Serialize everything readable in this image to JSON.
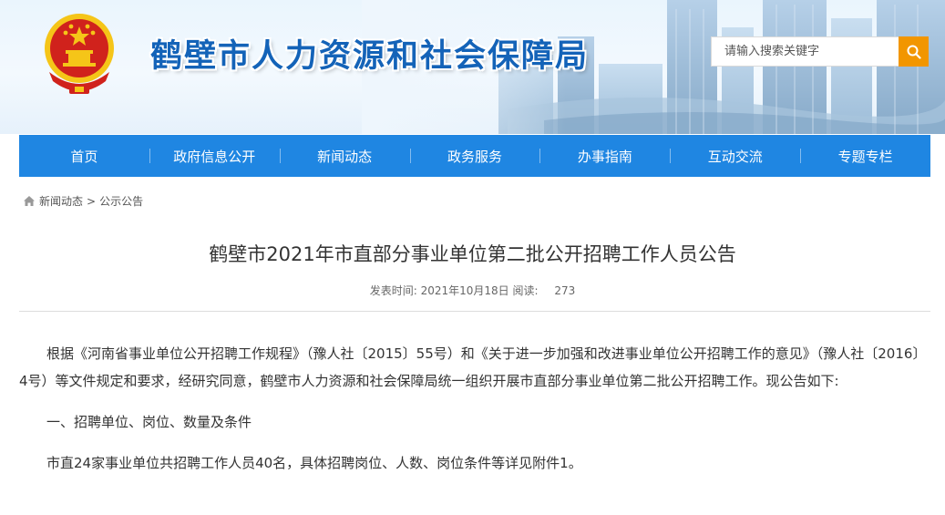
{
  "header": {
    "site_title": "鹤壁市人力资源和社会保障局",
    "search_placeholder": "请输入搜索关键字",
    "emblem_icon": "national-emblem-icon",
    "search_icon": "search-icon"
  },
  "nav": {
    "items": [
      "首页",
      "政府信息公开",
      "新闻动态",
      "政务服务",
      "办事指南",
      "互动交流",
      "专题专栏"
    ]
  },
  "breadcrumb": {
    "icon": "home-icon",
    "items": [
      "新闻动态",
      "公示公告"
    ],
    "separator": ">"
  },
  "article": {
    "title": "鹤壁市2021年市直部分事业单位第二批公开招聘工作人员公告",
    "publish_label": "发表时间:",
    "publish_date": "2021年10月18日",
    "views_label": "阅读:",
    "views": "273",
    "paragraphs": [
      "根据《河南省事业单位公开招聘工作规程》（豫人社〔2015〕55号）和《关于进一步加强和改进事业单位公开招聘工作的意见》（豫人社〔2016〕4号）等文件规定和要求，经研究同意，鹤壁市人力资源和社会保障局统一组织开展市直部分事业单位第二批公开招聘工作。现公告如下:",
      "一、招聘单位、岗位、数量及条件",
      "市直24家事业单位共招聘工作人员40名，具体招聘岗位、人数、岗位条件等详见附件1。"
    ]
  },
  "colors": {
    "nav_bg": "#1f86e2",
    "title_blue": "#1463b8",
    "search_button": "#f29600",
    "emblem_red": "#d0221c",
    "emblem_gold": "#f5c518"
  }
}
